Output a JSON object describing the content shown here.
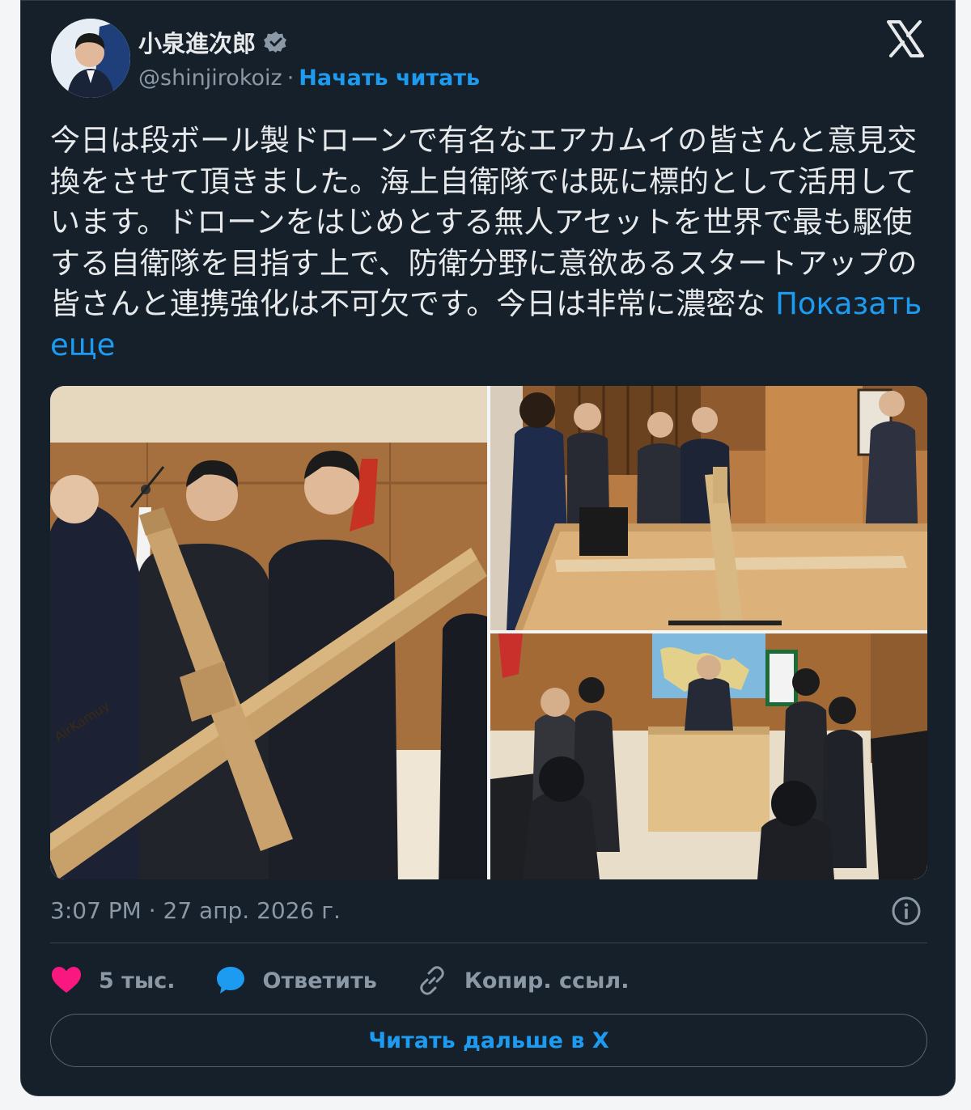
{
  "author": {
    "name": "小泉進次郎",
    "handle": "@shinjirokoiz",
    "separator": "·",
    "follow_label": "Начать читать",
    "verified_icon": "verified-badge-icon"
  },
  "tweet": {
    "text": "今日は段ボール製ドローンで有名なエアカムイの皆さんと意見交換をさせて頂きました。海上自衛隊では既に標的として活用しています。ドローンをはじめとする無人アセットを世界で最も駆使する自衛隊を目指す上で、防衛分野に意欲あるスタートアップの皆さんと連携強化は不可欠です。今日は非常に濃密な ",
    "show_more": "Показать еще",
    "timestamp": "3:07 PM · 27 апр. 2026 г."
  },
  "media": {
    "photo1_text": "AirKamuy"
  },
  "actions": {
    "likes": "5 тыс.",
    "reply": "Ответить",
    "copy_link": "Копир. ссыл."
  },
  "read_more": "Читать дальше в X",
  "colors": {
    "background": "#15202b",
    "accent": "#1d9bf0",
    "like": "#f91880",
    "muted": "#8b98a5",
    "text": "#e7e9ea"
  }
}
